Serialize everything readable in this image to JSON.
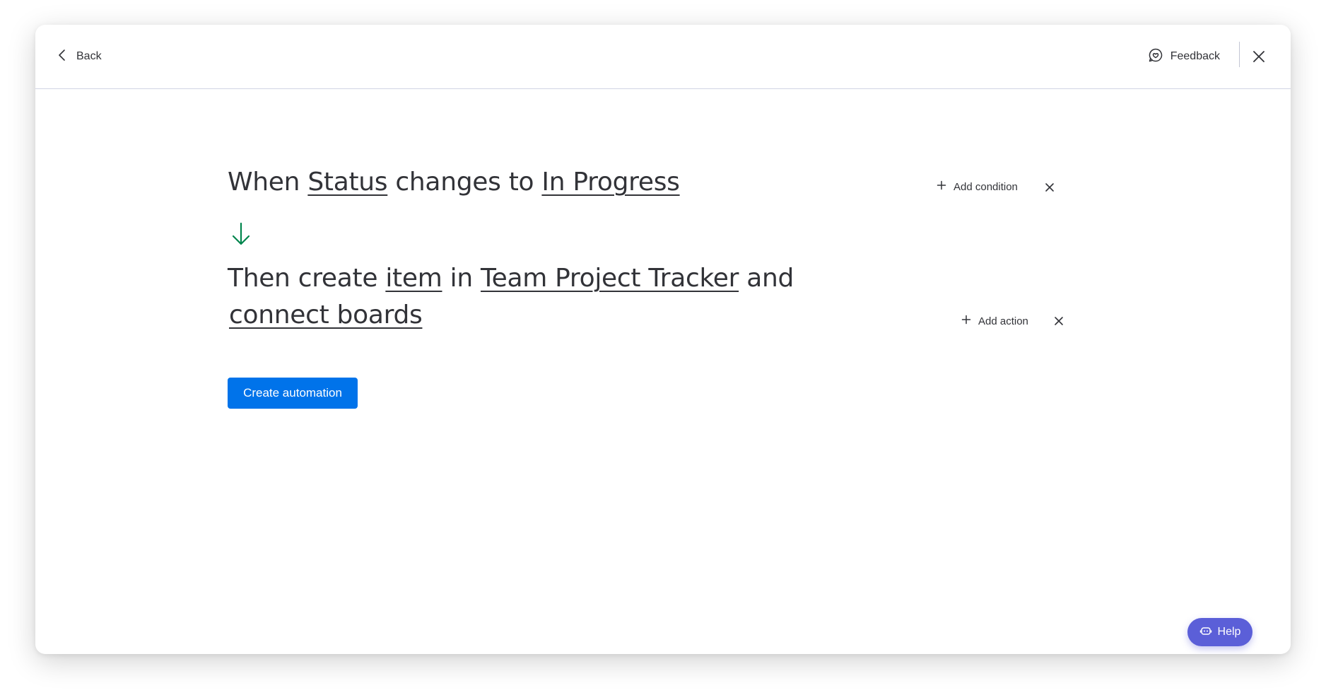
{
  "topbar": {
    "back_label": "Back",
    "feedback_label": "Feedback"
  },
  "trigger": {
    "prefix": "When",
    "column": "Status",
    "middle": "changes to",
    "value": "In Progress"
  },
  "action": {
    "prefix": "Then create",
    "item": "item",
    "middle": "in",
    "board": "Team Project Tracker",
    "suffix": "and",
    "connect": "connect boards"
  },
  "buttons": {
    "add_condition": "Add condition",
    "add_action": "Add action",
    "create": "Create automation",
    "help": "Help"
  },
  "colors": {
    "primary": "#0073ea",
    "arrow": "#00854d",
    "help": "#5b5fd8"
  }
}
